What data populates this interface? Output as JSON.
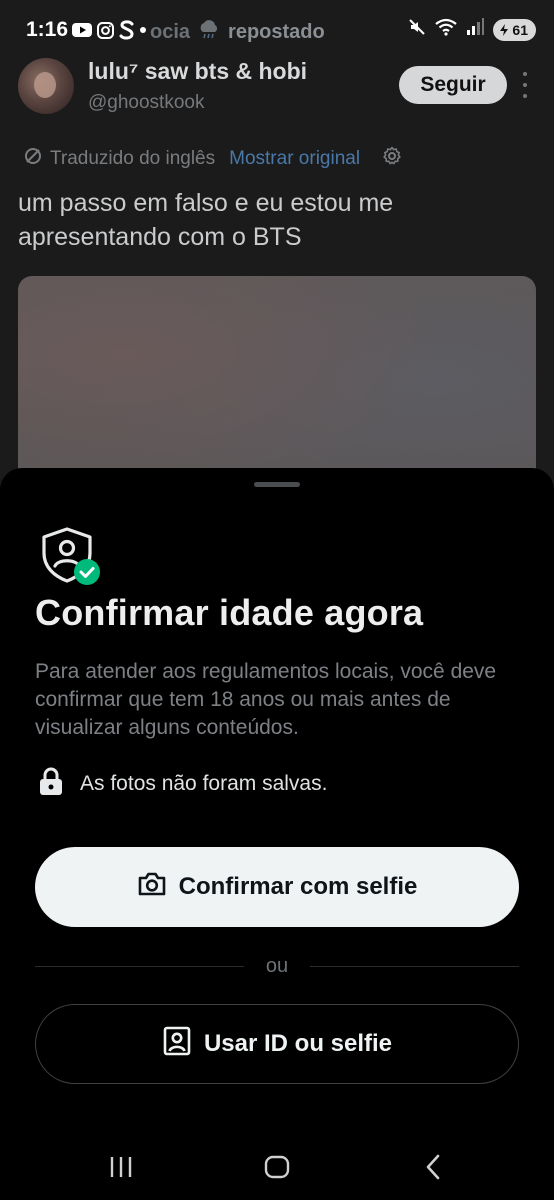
{
  "status_bar": {
    "time": "1:16",
    "left_icons": [
      "youtube-icon",
      "instagram-icon",
      "s-app-icon",
      "dot-icon"
    ],
    "battery": "61",
    "right_icons": [
      "mute-icon",
      "wifi-icon",
      "signal-icon",
      "battery-icon"
    ]
  },
  "repost_context": {
    "partial_text": "ocia",
    "label": "repostado"
  },
  "tweet": {
    "author_name": "lulu⁷ saw bts & hobi",
    "author_handle": "@ghoostkook",
    "follow_label": "Seguir",
    "translated_label": "Traduzido do inglês",
    "show_original_label": "Mostrar original",
    "text": "um passo em falso e eu estou me apresentando com o BTS"
  },
  "sheet": {
    "title": "Confirmar idade agora",
    "description": "Para atender aos regulamentos locais, você deve confirmar que tem 18 anos ou mais antes de visualizar alguns conteúdos.",
    "privacy_note": "As fotos não foram salvas.",
    "primary_button_label": "Confirmar com selfie",
    "divider_label": "ou",
    "secondary_button_label": "Usar ID ou selfie"
  },
  "colors": {
    "background": "#000000",
    "primary_button_bg": "#eff3f4",
    "link_blue": "#4a78a8",
    "check_green": "#00ba7c",
    "muted_text": "#7d8185"
  }
}
